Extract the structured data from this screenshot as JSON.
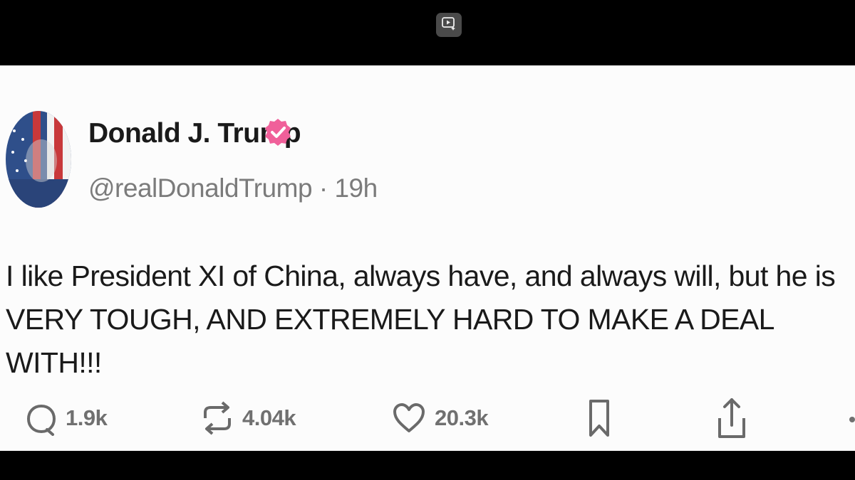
{
  "player": {
    "icon": "video-icon"
  },
  "post": {
    "author": {
      "name": "Donald J. Trump",
      "verified_icon": "verified-badge-icon",
      "verified_color": "#f0609a",
      "avatar": "flag-portrait-avatar"
    },
    "handle": "@realDonaldTrump",
    "separator": "·",
    "time": "19h",
    "text": "I like President XI of China, always have, and always will, but he is VERY TOUGH, AND EXTREMELY HARD TO MAKE A DEAL WITH!!!",
    "actions": {
      "replies": {
        "icon": "reply-icon",
        "count": "1.9k"
      },
      "retruths": {
        "icon": "repost-icon",
        "count": "4.04k"
      },
      "likes": {
        "icon": "heart-icon",
        "count": "20.3k"
      },
      "bookmark": {
        "icon": "bookmark-icon"
      },
      "share": {
        "icon": "share-icon"
      }
    }
  }
}
